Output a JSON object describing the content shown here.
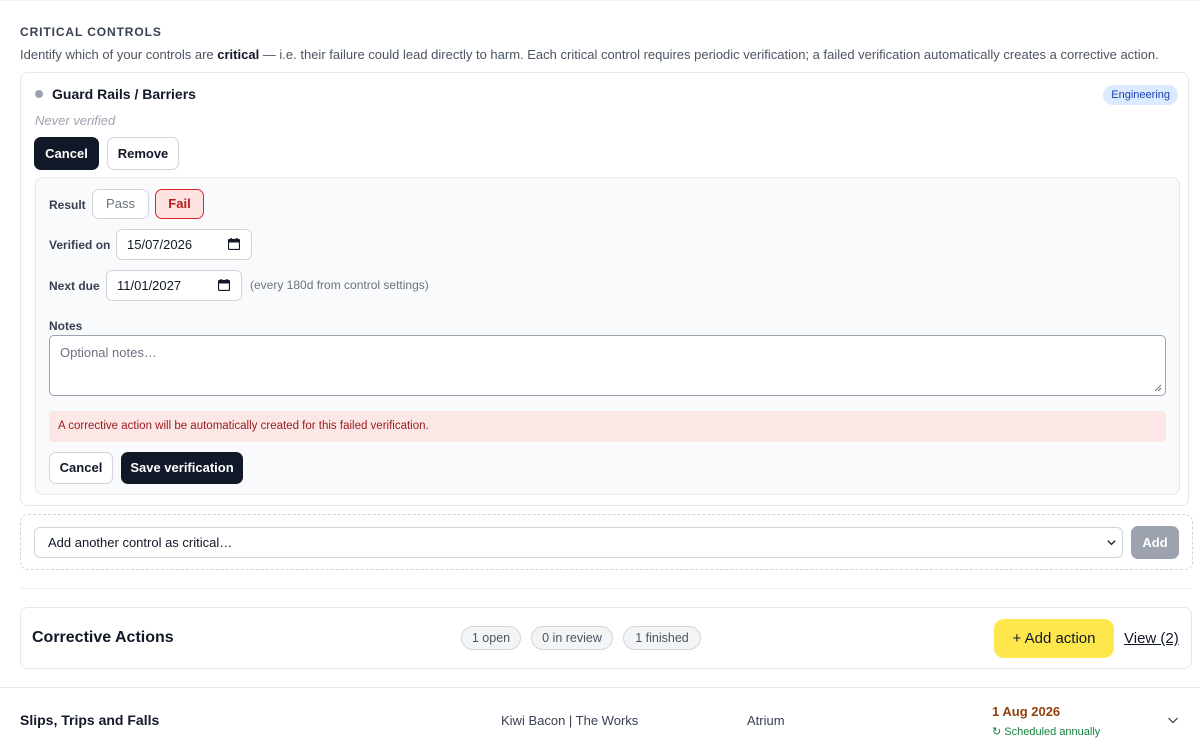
{
  "critical_controls": {
    "title": "CRITICAL CONTROLS",
    "desc_before": "Identify which of your controls are ",
    "desc_bold": "critical",
    "desc_after": " — i.e. their failure could lead directly to harm. Each critical control requires periodic verification; a failed verification automatically creates a corrective action."
  },
  "control": {
    "name": "Guard Rails / Barriers",
    "category": "Engineering",
    "status": "Never verified",
    "cancel_label": "Cancel",
    "remove_label": "Remove"
  },
  "verification": {
    "result_label": "Result",
    "pass_label": "Pass",
    "fail_label": "Fail",
    "selected_result": "Fail",
    "verified_on_label": "Verified on",
    "verified_on_value": "15/07/2026",
    "next_due_label": "Next due",
    "next_due_value": "11/01/2027",
    "next_due_hint": "(every 180d from control settings)",
    "notes_label": "Notes",
    "notes_placeholder": "Optional notes…",
    "warning": "A corrective action will be automatically created for this failed verification.",
    "cancel_label": "Cancel",
    "save_label": "Save verification"
  },
  "add_control": {
    "select_value": "Add another control as critical…",
    "add_label": "Add"
  },
  "corrective_actions": {
    "title": "Corrective Actions",
    "open": "1 open",
    "in_review": "0 in review",
    "finished": "1 finished",
    "add_label": "+ Add action",
    "view_label": "View (2)"
  },
  "hazard_row": {
    "name": "Slips, Trips and Falls",
    "site": "Kiwi Bacon | The Works",
    "location": "Atrium",
    "due_date": "1 Aug 2026",
    "schedule": "↻ Scheduled annually"
  },
  "colors": {
    "primary_dark": "#111827",
    "fail_red": "#dc2626",
    "add_action_yellow": "#fde74c",
    "badge_blue": "#dbeafe",
    "due_brown": "#92400e",
    "schedule_green": "#15803d"
  }
}
